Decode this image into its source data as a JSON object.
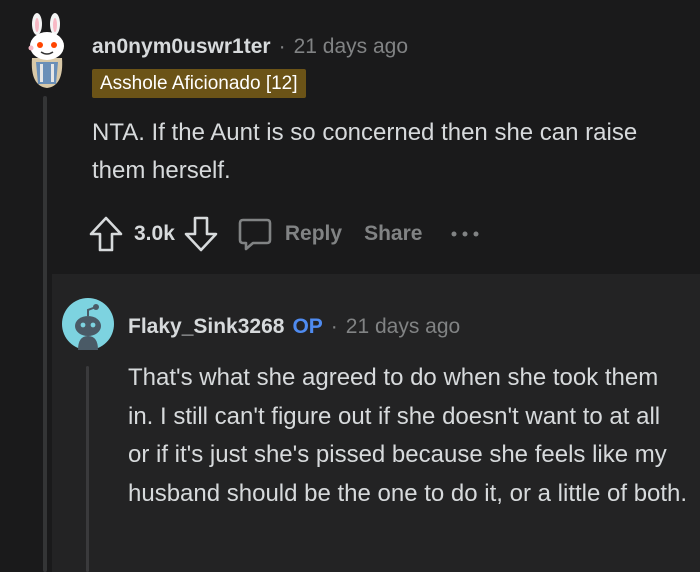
{
  "comment": {
    "username": "an0nym0uswr1ter",
    "separator": "·",
    "time": "21 days ago",
    "flair": "Asshole Aficionado [12]",
    "body": "NTA. If the Aunt is so concerned then she can raise them herself.",
    "votes": "3.0k",
    "reply_label": "Reply",
    "share_label": "Share",
    "icons": [
      "snoo-avatar-bunny",
      "upvote-icon",
      "downvote-icon",
      "reply-icon",
      "more-icon"
    ]
  },
  "reply": {
    "username": "Flaky_Sink3268",
    "op_badge": "OP",
    "separator": "·",
    "time": "21 days ago",
    "body": "That's what she agreed to do when she took them in. I still can't figure out if she doesn't want to at all or if it's just she's pissed because she feels like my husband should be the one to do it, or a little of both.",
    "avatar_color": "#7dd3e0"
  },
  "colors": {
    "background": "#1a1a1b",
    "reply_background": "#232324",
    "text": "#d7dadc",
    "muted": "#818384",
    "flair_bg": "#6b5317",
    "op": "#4f8bf0"
  }
}
